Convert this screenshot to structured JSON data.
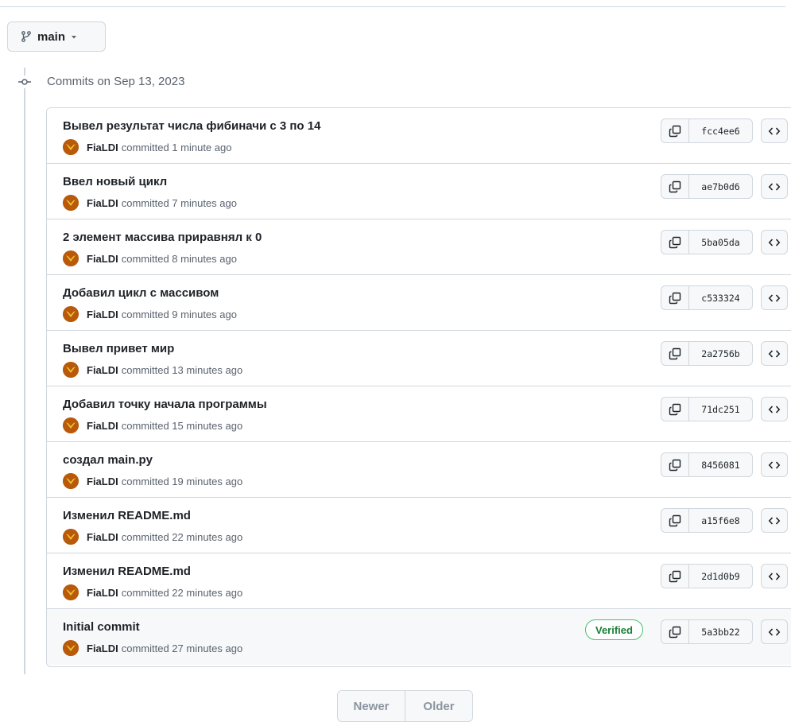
{
  "branch": {
    "name": "main"
  },
  "heading": "Commits on Sep 13, 2023",
  "commits": [
    {
      "title": "Вывел результат числа фибиначи с 3 по 14",
      "author": "FiaLDI",
      "time": "committed 1 minute ago",
      "sha": "fcc4ee6",
      "verified": ""
    },
    {
      "title": "Ввел новый цикл",
      "author": "FiaLDI",
      "time": "committed 7 minutes ago",
      "sha": "ae7b0d6",
      "verified": ""
    },
    {
      "title": "2 элемент массива приравнял к 0",
      "author": "FiaLDI",
      "time": "committed 8 minutes ago",
      "sha": "5ba05da",
      "verified": ""
    },
    {
      "title": "Добавил цикл с массивом",
      "author": "FiaLDI",
      "time": "committed 9 minutes ago",
      "sha": "c533324",
      "verified": ""
    },
    {
      "title": "Вывел привет мир",
      "author": "FiaLDI",
      "time": "committed 13 minutes ago",
      "sha": "2a2756b",
      "verified": ""
    },
    {
      "title": "Добавил точку начала программы",
      "author": "FiaLDI",
      "time": "committed 15 minutes ago",
      "sha": "71dc251",
      "verified": ""
    },
    {
      "title": "создал main.py",
      "author": "FiaLDI",
      "time": "committed 19 minutes ago",
      "sha": "8456081",
      "verified": ""
    },
    {
      "title": "Изменил README.md",
      "author": "FiaLDI",
      "time": "committed 22 minutes ago",
      "sha": "a15f6e8",
      "verified": ""
    },
    {
      "title": "Изменил README.md",
      "author": "FiaLDI",
      "time": "committed 22 minutes ago",
      "sha": "2d1d0b9",
      "verified": ""
    },
    {
      "title": "Initial commit",
      "author": "FiaLDI",
      "time": "committed 27 minutes ago",
      "sha": "5a3bb22",
      "verified": "Verified"
    }
  ],
  "pagination": {
    "newer": "Newer",
    "older": "Older"
  },
  "icons": {
    "branch": "git-branch-icon",
    "caret": "triangle-down-icon",
    "timeline": "git-commit-icon",
    "copy": "copy-icon",
    "browse": "code-icon",
    "avatar": "avatar-image"
  },
  "colors": {
    "verified": "#1a7f37",
    "avatar": "#b85a09",
    "border": "#d0d7de"
  }
}
